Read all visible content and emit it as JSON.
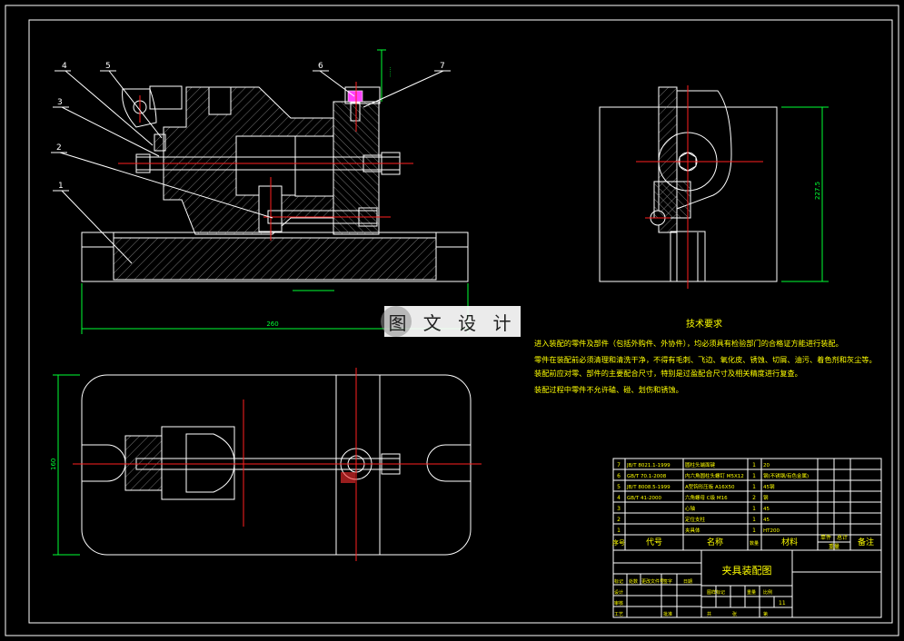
{
  "colors": {
    "background": "#000000",
    "outline": "#ffffff",
    "centerline": "#ff2020",
    "dimension": "#00ff33",
    "text": "#ffff00",
    "watermark_bg": "#ffffff"
  },
  "watermark": {
    "text": "图 文 设 计"
  },
  "balloons": [
    "1",
    "2",
    "3",
    "4",
    "5",
    "6",
    "7"
  ],
  "dimensions": {
    "front_width": "260",
    "side_height": "227.5",
    "top_height": "160",
    "top_right": "?"
  },
  "tech_requirements": {
    "title": "技术要求",
    "lines": [
      "进入装配的零件及部件（包括外购件、外协件），均必须具有检验部门的合格证方能进行装配。",
      "零件在装配前必须清理和清洗干净，不得有毛刺、飞边、氧化皮、锈蚀、切屑、油污、着色剂和灰尘等。",
      "装配前应对零、部件的主要配合尺寸，特别是过盈配合尺寸及相关精度进行复查。",
      "装配过程中零件不允许磕、碰、划伤和锈蚀。"
    ]
  },
  "bom": {
    "rows": [
      {
        "no": "7",
        "code": "JB/T 8021.1-1999",
        "name": "圆柱头端面键",
        "qty": "1",
        "material": "20"
      },
      {
        "no": "6",
        "code": "GB/T 70.1-2008",
        "name": "内六角圆柱头螺钉 M5X12",
        "qty": "1",
        "material": "钢(不锈钢/有色金属)"
      },
      {
        "no": "5",
        "code": "JB/T 8008.5-1999",
        "name": "A型钩形压板 A16X50",
        "qty": "1",
        "material": "45钢"
      },
      {
        "no": "4",
        "code": "GB/T 41-2000",
        "name": "六角螺母 C级 M16",
        "qty": "2",
        "material": "钢"
      },
      {
        "no": "3",
        "code": "",
        "name": "心轴",
        "qty": "1",
        "material": "45"
      },
      {
        "no": "2",
        "code": "",
        "name": "定位支柱",
        "qty": "1",
        "material": "45"
      },
      {
        "no": "1",
        "code": "",
        "name": "夹具体",
        "qty": "1",
        "material": "HT200"
      }
    ],
    "headers": {
      "no": "序号",
      "code": "代号",
      "name": "名称",
      "qty": "数量",
      "material": "材料",
      "unit": "单件",
      "total": "总计",
      "weight": "重量",
      "remark": "备注"
    }
  },
  "title_block": {
    "drawing_title": "夹具装配图",
    "sheet_count": "11",
    "labels": [
      "标记",
      "处数",
      "更改文件号",
      "签字",
      "日期",
      "设计",
      "审核",
      "工艺",
      "批准",
      "图样标记",
      "重量",
      "比例",
      "共",
      "张",
      "第"
    ]
  }
}
